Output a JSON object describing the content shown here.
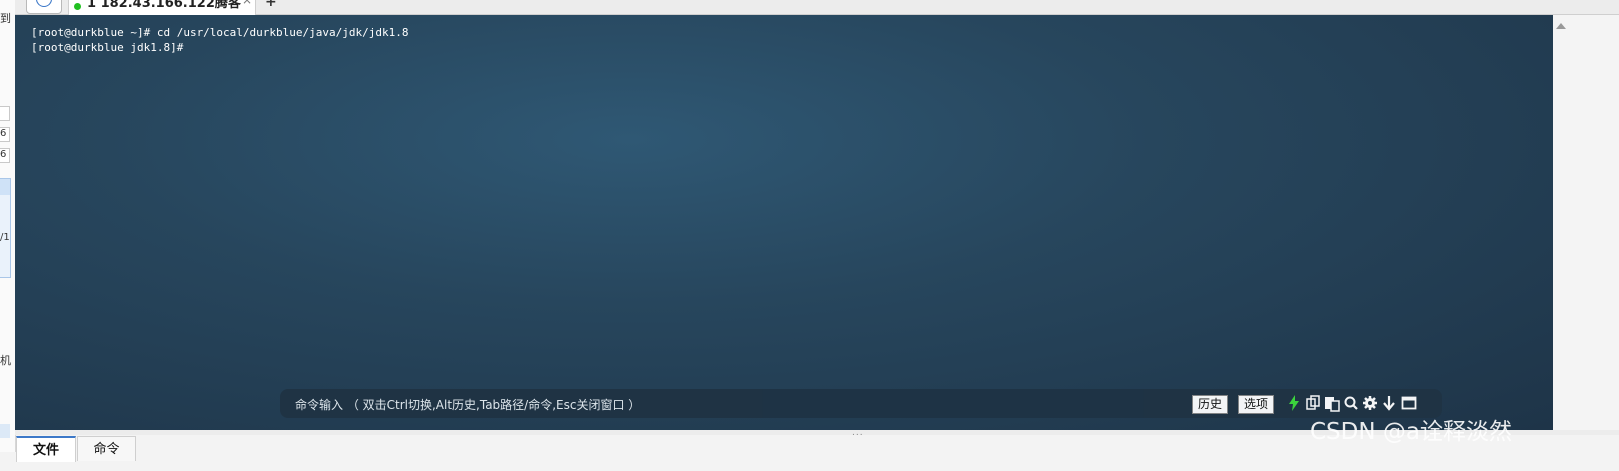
{
  "window": {
    "tab_title": "1 182.43.166.122腾客",
    "tab_close": "×",
    "tab_add": "+",
    "connected_color": "#21c021"
  },
  "left_panel": {
    "fragments": [
      "到",
      "6",
      "6",
      "/1",
      "机"
    ]
  },
  "terminal": {
    "lines": [
      "[root@durkblue ~]# cd /usr/local/durkblue/java/jdk/jdk1.8",
      "[root@durkblue jdk1.8]#"
    ],
    "background_color": "#27465d",
    "text_color": "#ffffff"
  },
  "command_bar": {
    "placeholder": "命令输入 （ 双击Ctrl切换,Alt历史,Tab路径/命令,Esc关闭窗口 ）",
    "history_button": "历史",
    "options_button": "选项",
    "icons": [
      "lightning-icon",
      "copy-icon",
      "paste-icon",
      "search-icon",
      "gear-icon",
      "download-icon",
      "maximize-icon"
    ]
  },
  "splitter_grip": "...",
  "bottom_tabs": [
    {
      "label": "文件",
      "active": true
    },
    {
      "label": "命令",
      "active": false
    }
  ],
  "watermark": "CSDN @a诠释淡然"
}
